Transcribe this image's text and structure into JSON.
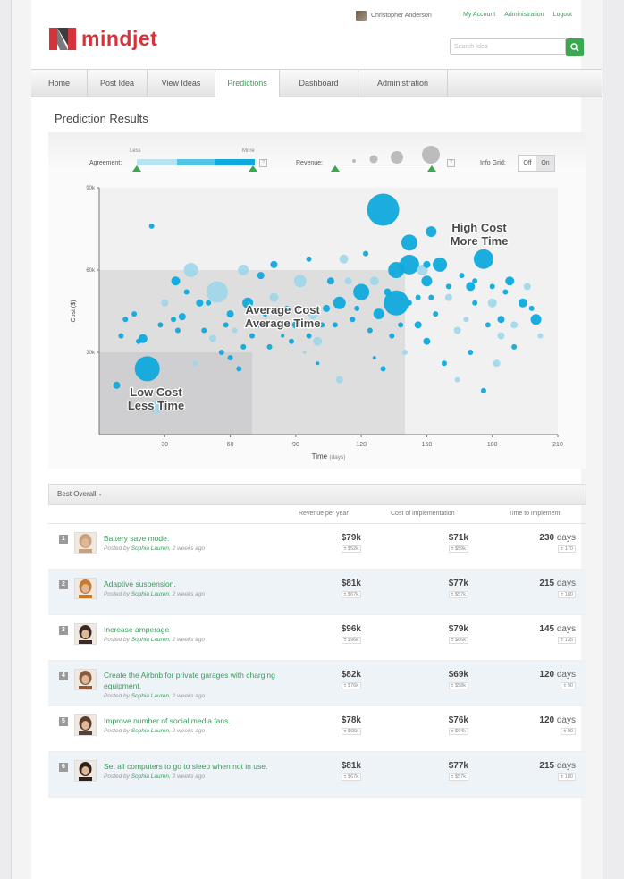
{
  "header": {
    "user_name": "Christopher Anderson",
    "links": [
      "My Account",
      "Administration",
      "Logout"
    ],
    "logo_text": "mindjet",
    "search_placeholder": "Search Idea"
  },
  "nav": {
    "tabs": [
      "Home",
      "Post Idea",
      "View Ideas",
      "Predictions",
      "Dashboard",
      "Administration"
    ],
    "active": "Predictions"
  },
  "page_title": "Prediction Results",
  "controls": {
    "agreement_label": "Agreement:",
    "agreement_less": "Less",
    "agreement_more": "More",
    "revenue_label": "Revenue:",
    "info_grid_label": "Info Grid:",
    "info_grid_off": "Off",
    "info_grid_on": "On",
    "help": "?"
  },
  "chart_data": {
    "type": "scatter",
    "xlabel": "Time",
    "xlabel_unit": "(days)",
    "ylabel": "Cost ($)",
    "xlim": [
      0,
      210
    ],
    "ylim": [
      0,
      90
    ],
    "x_ticks": [
      30,
      60,
      90,
      120,
      150,
      180,
      210
    ],
    "y_ticks": [
      {
        "value": 30,
        "label": "30k"
      },
      {
        "value": 60,
        "label": "60k"
      },
      {
        "value": 90,
        "label": "90k"
      }
    ],
    "regions": [
      {
        "label_lines": [
          "Low Cost",
          "Less Time"
        ],
        "x": [
          0,
          70
        ],
        "y": [
          0,
          30
        ]
      },
      {
        "label_lines": [
          "Average Cost",
          "Average Time"
        ],
        "x": [
          0,
          140
        ],
        "y": [
          0,
          60
        ]
      },
      {
        "label_lines": [
          "High Cost",
          "More Time"
        ],
        "x": [
          140,
          210
        ],
        "y": [
          60,
          90
        ]
      }
    ],
    "colors": {
      "strong": "#0fa9dc",
      "light": "#9ad6ea",
      "grid_dark": "#cfcfd1",
      "grid_mid": "#dededf"
    },
    "points": [
      [
        22,
        24,
        14,
        1
      ],
      [
        26,
        10,
        7,
        0
      ],
      [
        8,
        18,
        4,
        1
      ],
      [
        20,
        35,
        5,
        1
      ],
      [
        35,
        56,
        5,
        1
      ],
      [
        42,
        60,
        8,
        0
      ],
      [
        54,
        52,
        12,
        0
      ],
      [
        38,
        43,
        4,
        1
      ],
      [
        52,
        35,
        4,
        0
      ],
      [
        60,
        28,
        3,
        1
      ],
      [
        68,
        48,
        6,
        1
      ],
      [
        74,
        58,
        4,
        1
      ],
      [
        80,
        50,
        5,
        0
      ],
      [
        90,
        40,
        4,
        1
      ],
      [
        100,
        34,
        5,
        0
      ],
      [
        110,
        48,
        7,
        1
      ],
      [
        120,
        52,
        9,
        1
      ],
      [
        128,
        44,
        6,
        1
      ],
      [
        130,
        82,
        18,
        1
      ],
      [
        136,
        48,
        14,
        1
      ],
      [
        142,
        62,
        11,
        1
      ],
      [
        150,
        56,
        6,
        1
      ],
      [
        156,
        62,
        8,
        1
      ],
      [
        160,
        50,
        4,
        0
      ],
      [
        170,
        54,
        5,
        1
      ],
      [
        176,
        64,
        11,
        1
      ],
      [
        180,
        48,
        5,
        0
      ],
      [
        184,
        42,
        4,
        1
      ],
      [
        190,
        40,
        4,
        0
      ],
      [
        200,
        42,
        6,
        1
      ],
      [
        196,
        54,
        4,
        0
      ],
      [
        188,
        56,
        5,
        1
      ],
      [
        164,
        38,
        4,
        0
      ],
      [
        150,
        34,
        4,
        1
      ],
      [
        140,
        30,
        3,
        0
      ],
      [
        170,
        30,
        3,
        1
      ],
      [
        184,
        36,
        4,
        0
      ],
      [
        194,
        48,
        5,
        1
      ],
      [
        110,
        20,
        4,
        0
      ],
      [
        112,
        64,
        5,
        0
      ],
      [
        118,
        46,
        3,
        1
      ],
      [
        122,
        66,
        3,
        1
      ],
      [
        136,
        60,
        9,
        1
      ],
      [
        142,
        70,
        9,
        1
      ],
      [
        148,
        60,
        6,
        0
      ],
      [
        152,
        74,
        6,
        1
      ],
      [
        80,
        62,
        4,
        1
      ],
      [
        66,
        60,
        6,
        0
      ],
      [
        24,
        76,
        3,
        1
      ],
      [
        46,
        48,
        4,
        1
      ],
      [
        60,
        44,
        4,
        1
      ],
      [
        30,
        48,
        4,
        0
      ],
      [
        16,
        44,
        3,
        1
      ],
      [
        92,
        56,
        7,
        0
      ],
      [
        98,
        44,
        6,
        0
      ],
      [
        104,
        46,
        4,
        1
      ],
      [
        86,
        46,
        3,
        1
      ],
      [
        106,
        56,
        4,
        1
      ],
      [
        114,
        56,
        4,
        0
      ],
      [
        72,
        40,
        4,
        1
      ],
      [
        76,
        44,
        3,
        1
      ],
      [
        62,
        38,
        3,
        0
      ],
      [
        48,
        38,
        3,
        1
      ],
      [
        56,
        30,
        3,
        1
      ],
      [
        44,
        26,
        3,
        0
      ],
      [
        64,
        24,
        3,
        1
      ],
      [
        146,
        40,
        4,
        1
      ],
      [
        158,
        26,
        3,
        1
      ],
      [
        164,
        20,
        3,
        0
      ],
      [
        176,
        16,
        3,
        1
      ],
      [
        130,
        24,
        3,
        1
      ],
      [
        126,
        28,
        2,
        1
      ],
      [
        100,
        26,
        2,
        1
      ],
      [
        94,
        30,
        2,
        0
      ],
      [
        84,
        36,
        2,
        1
      ],
      [
        150,
        62,
        4,
        1
      ],
      [
        172,
        48,
        3,
        1
      ],
      [
        186,
        52,
        3,
        1
      ],
      [
        198,
        46,
        3,
        1
      ],
      [
        178,
        40,
        3,
        1
      ],
      [
        168,
        42,
        3,
        0
      ],
      [
        154,
        44,
        3,
        1
      ],
      [
        202,
        36,
        3,
        0
      ],
      [
        182,
        26,
        4,
        0
      ],
      [
        190,
        32,
        3,
        1
      ],
      [
        96,
        64,
        3,
        1
      ],
      [
        126,
        56,
        5,
        0
      ],
      [
        132,
        52,
        4,
        1
      ],
      [
        138,
        40,
        3,
        1
      ],
      [
        40,
        52,
        3,
        1
      ],
      [
        50,
        48,
        3,
        1
      ],
      [
        34,
        42,
        3,
        1
      ],
      [
        28,
        40,
        3,
        1
      ],
      [
        10,
        36,
        3,
        1
      ],
      [
        12,
        42,
        3,
        1
      ],
      [
        18,
        34,
        3,
        1
      ],
      [
        36,
        38,
        3,
        1
      ],
      [
        58,
        40,
        3,
        1
      ],
      [
        66,
        32,
        3,
        1
      ],
      [
        70,
        36,
        3,
        1
      ],
      [
        78,
        32,
        3,
        1
      ],
      [
        88,
        34,
        3,
        1
      ],
      [
        96,
        36,
        3,
        1
      ],
      [
        102,
        40,
        3,
        1
      ],
      [
        108,
        40,
        3,
        1
      ],
      [
        116,
        42,
        3,
        1
      ],
      [
        124,
        38,
        3,
        1
      ],
      [
        134,
        36,
        3,
        1
      ],
      [
        142,
        48,
        3,
        1
      ],
      [
        146,
        50,
        3,
        1
      ],
      [
        152,
        50,
        3,
        1
      ],
      [
        160,
        54,
        3,
        1
      ],
      [
        166,
        58,
        3,
        1
      ],
      [
        172,
        56,
        3,
        1
      ],
      [
        180,
        54,
        3,
        1
      ]
    ]
  },
  "table": {
    "title": "Best Overall",
    "columns": [
      "Revenue per year",
      "Cost of implementation",
      "Time to implement"
    ],
    "rows": [
      {
        "rank": "1",
        "title": "Battery save mode.",
        "author": "Sophia Lauren",
        "when": "2 weeks ago",
        "revenue": "$79k",
        "revenue_sub": "± $52k",
        "cost": "$71k",
        "cost_sub": "± $59k",
        "time": "230",
        "time_sub": "± 170",
        "face": "f1"
      },
      {
        "rank": "2",
        "title": "Adaptive suspension.",
        "author": "Sophia Lauren",
        "when": "2 weeks ago",
        "revenue": "$81k",
        "revenue_sub": "± $67k",
        "cost": "$77k",
        "cost_sub": "± $57k",
        "time": "215",
        "time_sub": "± 180",
        "face": "tiger"
      },
      {
        "rank": "3",
        "title": "Increase amperage",
        "author": "Sophia Lauren",
        "when": "2 weeks ago",
        "revenue": "$96k",
        "revenue_sub": "± $96k",
        "cost": "$79k",
        "cost_sub": "± $66k",
        "time": "145",
        "time_sub": "± 135",
        "face": "f3"
      },
      {
        "rank": "4",
        "title": "Create the Airbnb for private garages with charging equipment.",
        "author": "Sophia Lauren",
        "when": "2 weeks ago",
        "revenue": "$82k",
        "revenue_sub": "± $76k",
        "cost": "$69k",
        "cost_sub": "± $58k",
        "time": "120",
        "time_sub": "± 90",
        "face": "f4"
      },
      {
        "rank": "5",
        "title": "Improve number of social media fans.",
        "author": "Sophia Lauren",
        "when": "2 weeks ago",
        "revenue": "$78k",
        "revenue_sub": "± $65k",
        "cost": "$76k",
        "cost_sub": "± $64k",
        "time": "120",
        "time_sub": "± 90",
        "face": "f5"
      },
      {
        "rank": "6",
        "title": "Set all computers to go to sleep when not in use.",
        "author": "Sophia Lauren",
        "when": "2 weeks ago",
        "revenue": "$81k",
        "revenue_sub": "± $67k",
        "cost": "$77k",
        "cost_sub": "± $57k",
        "time": "215",
        "time_sub": "± 180",
        "face": "f6"
      }
    ],
    "posted_by": "Posted by",
    "days_unit": "days"
  }
}
